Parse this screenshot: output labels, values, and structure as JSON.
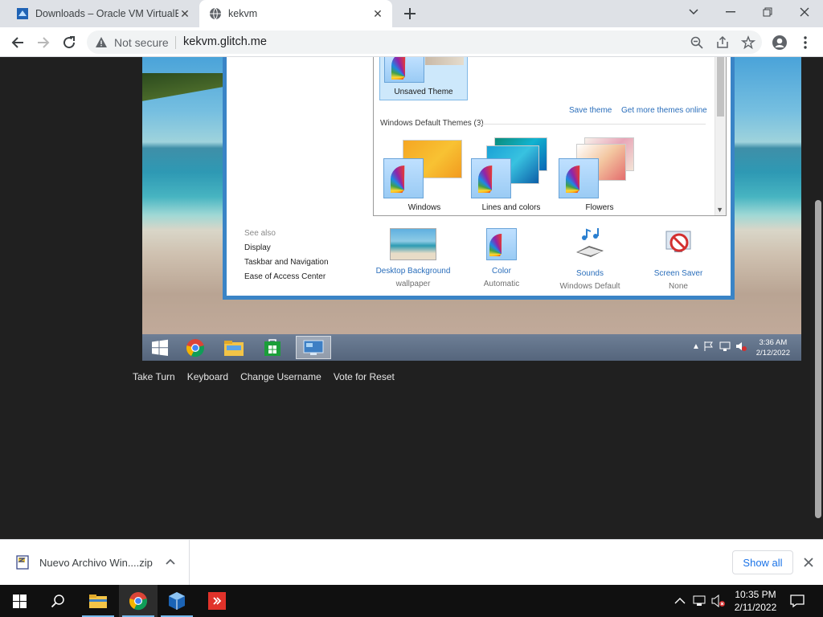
{
  "browser": {
    "tabs": [
      {
        "title": "Downloads – Oracle VM VirtualBox",
        "active": false
      },
      {
        "title": "kekvm",
        "active": true
      }
    ],
    "security_label": "Not secure",
    "url": "kekvm.glitch.me"
  },
  "vm": {
    "unsaved_theme_label": "Unsaved Theme",
    "save_theme": "Save theme",
    "get_more_themes": "Get more themes online",
    "default_themes_header": "Windows Default Themes (3)",
    "themes": [
      {
        "label": "Windows"
      },
      {
        "label": "Lines and colors"
      },
      {
        "label": "Flowers"
      }
    ],
    "see_also": {
      "header": "See also",
      "links": [
        "Display",
        "Taskbar and Navigation",
        "Ease of Access Center"
      ]
    },
    "bottom_items": [
      {
        "label": "Desktop Background",
        "sub": "wallpaper",
        "icon": "desktop-background-icon"
      },
      {
        "label": "Color",
        "sub": "Automatic",
        "icon": "color-palette-icon"
      },
      {
        "label": "Sounds",
        "sub": "Windows Default",
        "icon": "sounds-icon"
      },
      {
        "label": "Screen Saver",
        "sub": "None",
        "icon": "screen-saver-icon"
      }
    ],
    "taskbar": {
      "apps": [
        "start-icon",
        "chrome-icon",
        "file-explorer-icon",
        "store-icon",
        "personalization-icon"
      ],
      "time": "3:36 AM",
      "date": "2/12/2022"
    }
  },
  "controls": {
    "take_turn": "Take Turn",
    "keyboard": "Keyboard",
    "change_username": "Change Username",
    "vote_reset": "Vote for Reset"
  },
  "download_bar": {
    "file_name": "Nuevo Archivo Win....zip",
    "show_all": "Show all"
  },
  "host_taskbar": {
    "time": "10:35 PM",
    "date": "2/11/2022"
  }
}
